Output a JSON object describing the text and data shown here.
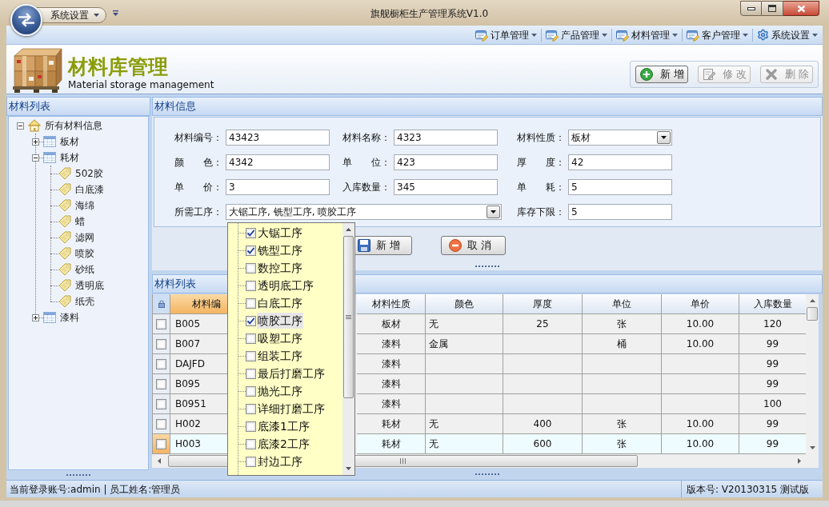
{
  "window": {
    "title": "旗舰橱柜生产管理系统V1.0",
    "quick_access": "系统设置"
  },
  "menu_bar": {
    "items": [
      {
        "label": "订单管理",
        "kind": "form"
      },
      {
        "label": "产品管理",
        "kind": "form"
      },
      {
        "label": "材料管理",
        "kind": "form"
      },
      {
        "label": "客户管理",
        "kind": "form"
      },
      {
        "label": "系统设置",
        "kind": "settings"
      }
    ]
  },
  "header": {
    "title": "材料库管理",
    "subtitle": "Material storage management",
    "buttons": [
      {
        "label": "新 增",
        "kind": "add",
        "disabled": false
      },
      {
        "label": "修 改",
        "kind": "edit",
        "disabled": true
      },
      {
        "label": "删 除",
        "kind": "delete",
        "disabled": true
      }
    ]
  },
  "sidebar": {
    "title": "材料列表",
    "tree": [
      {
        "label": "所有材料信息",
        "kind": "root",
        "expanded": true,
        "children": [
          {
            "label": "板材",
            "kind": "category",
            "expanded": false
          },
          {
            "label": "耗材",
            "kind": "category",
            "expanded": true,
            "children": [
              {
                "label": "502胶",
                "kind": "item"
              },
              {
                "label": "白底漆",
                "kind": "item"
              },
              {
                "label": "海绵",
                "kind": "item"
              },
              {
                "label": "蜡",
                "kind": "item"
              },
              {
                "label": "滤网",
                "kind": "item"
              },
              {
                "label": "喷胶",
                "kind": "item"
              },
              {
                "label": "砂纸",
                "kind": "item"
              },
              {
                "label": "透明底",
                "kind": "item"
              },
              {
                "label": "纸壳",
                "kind": "item"
              }
            ]
          },
          {
            "label": "漆料",
            "kind": "category",
            "expanded": false
          }
        ]
      }
    ]
  },
  "form": {
    "title": "材料信息",
    "fields": [
      {
        "label": "材料编号：",
        "value": "43423",
        "kind": "text"
      },
      {
        "label": "材料名称：",
        "value": "4323",
        "kind": "text"
      },
      {
        "label": "材料性质：",
        "value": "板材",
        "kind": "select"
      },
      {
        "label": "颜　　色：",
        "value": "4342",
        "kind": "text"
      },
      {
        "label": "单　　位：",
        "value": "423",
        "kind": "text"
      },
      {
        "label": "厚　　度：",
        "value": "42",
        "kind": "text"
      },
      {
        "label": "单　　价：",
        "value": "3",
        "kind": "text"
      },
      {
        "label": "入库数量：",
        "value": "345",
        "kind": "text"
      },
      {
        "label": "单　　耗：",
        "value": "5",
        "kind": "text"
      },
      {
        "label": "所需工序：",
        "value": "大锯工序, 铣型工序, 喷胶工序",
        "kind": "wide_select",
        "expanded": true,
        "options": [
          {
            "label": "大锯工序",
            "checked": true,
            "selected": false
          },
          {
            "label": "铣型工序",
            "checked": true,
            "selected": false
          },
          {
            "label": "数控工序",
            "checked": false,
            "selected": false
          },
          {
            "label": "透明底工序",
            "checked": false,
            "selected": false
          },
          {
            "label": "白底工序",
            "checked": false,
            "selected": false
          },
          {
            "label": "喷胶工序",
            "checked": true,
            "selected": true
          },
          {
            "label": "吸塑工序",
            "checked": false,
            "selected": false
          },
          {
            "label": "组装工序",
            "checked": false,
            "selected": false
          },
          {
            "label": "最后打磨工序",
            "checked": false,
            "selected": false
          },
          {
            "label": "抛光工序",
            "checked": false,
            "selected": false
          },
          {
            "label": "详细打磨工序",
            "checked": false,
            "selected": false
          },
          {
            "label": "底漆1工序",
            "checked": false,
            "selected": false
          },
          {
            "label": "底漆2工序",
            "checked": false,
            "selected": false
          },
          {
            "label": "封边工序",
            "checked": false,
            "selected": false
          }
        ]
      },
      {
        "label": "库存下限：",
        "value": "5",
        "kind": "text"
      }
    ],
    "buttons": [
      {
        "label": "新 增",
        "kind": "save"
      },
      {
        "label": "取 消",
        "kind": "cancel"
      }
    ]
  },
  "table": {
    "title": "材料列表",
    "columns": [
      {
        "label": "材料编",
        "selected": true
      },
      {
        "label": "材料性质",
        "selected": false
      },
      {
        "label": "颜色",
        "selected": false
      },
      {
        "label": "厚度",
        "selected": false
      },
      {
        "label": "单位",
        "selected": false
      },
      {
        "label": "单价",
        "selected": false
      },
      {
        "label": "入库数量",
        "selected": false
      }
    ],
    "rows": [
      {
        "selected": false,
        "checked": false,
        "cells": [
          "B005",
          "板材",
          "无",
          "25",
          "张",
          "10.00",
          "120"
        ]
      },
      {
        "selected": false,
        "checked": false,
        "cells": [
          "B007",
          "漆料",
          "金属",
          null,
          "桶",
          "10.00",
          "99"
        ]
      },
      {
        "selected": false,
        "checked": false,
        "cells": [
          "DAJFD",
          "漆料",
          null,
          null,
          null,
          null,
          "99"
        ]
      },
      {
        "selected": false,
        "checked": false,
        "cells": [
          "B095",
          "漆料",
          null,
          null,
          null,
          null,
          "99"
        ]
      },
      {
        "selected": false,
        "checked": false,
        "cells": [
          "B0951",
          "漆料",
          null,
          null,
          null,
          null,
          "100"
        ]
      },
      {
        "selected": false,
        "checked": false,
        "cells": [
          "H002",
          "耗材",
          "无",
          "400",
          "张",
          "10.00",
          "99"
        ]
      },
      {
        "selected": true,
        "checked": false,
        "cells": [
          "H003",
          "耗材",
          "无",
          "600",
          "张",
          "10.00",
          "99"
        ]
      }
    ]
  },
  "status_bar": {
    "account": "当前登录账号:admin | 员工姓名:管理员",
    "version": "版本号: V20130315 测试版"
  }
}
